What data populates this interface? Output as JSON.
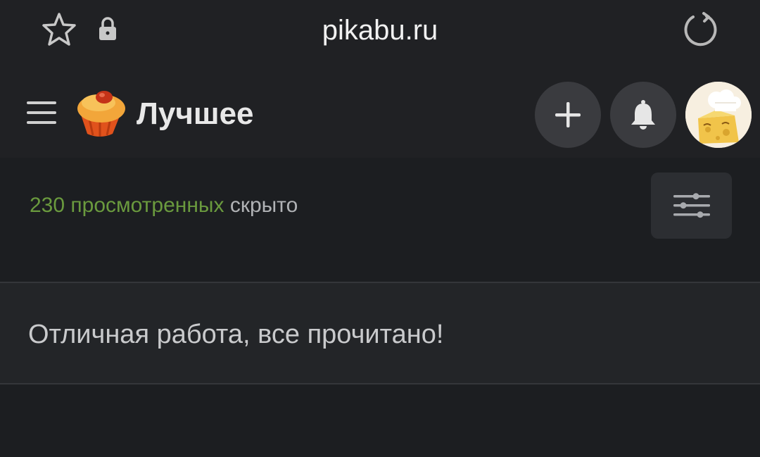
{
  "browser": {
    "url": "pikabu.ru"
  },
  "header": {
    "title": "Лучшее"
  },
  "filter_bar": {
    "viewed_count_text": "230 просмотренных",
    "hidden_text": "скрыто"
  },
  "feed": {
    "empty_message": "Отличная работа, все прочитано!"
  },
  "colors": {
    "background": "#1c1e21",
    "header": "#202124",
    "accent_green": "#6a9a3e",
    "button_bg": "#3a3b3f"
  },
  "icons": {
    "bookmark": "star-icon",
    "security": "lock-icon",
    "reload": "reload-icon",
    "menu": "hamburger-menu-icon",
    "logo": "pikabu-cupcake-logo",
    "add": "plus-icon",
    "notifications": "bell-icon",
    "filter": "sliders-icon"
  }
}
